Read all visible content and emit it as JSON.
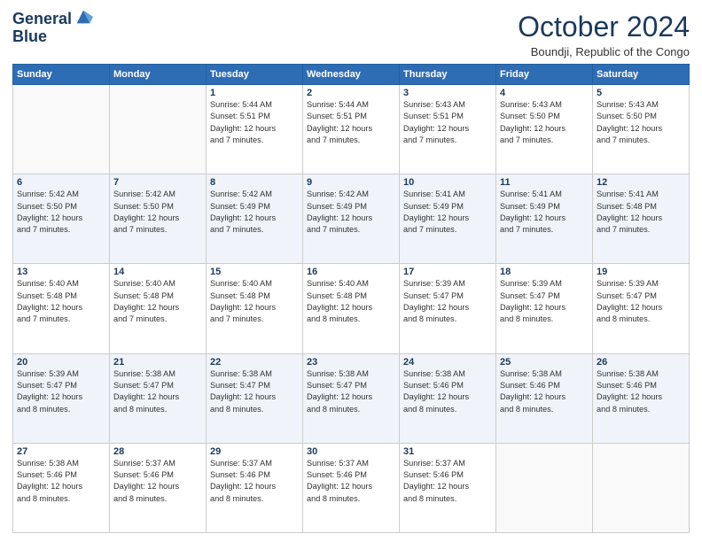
{
  "header": {
    "logo_line1": "General",
    "logo_line2": "Blue",
    "month": "October 2024",
    "location": "Boundji, Republic of the Congo"
  },
  "weekdays": [
    "Sunday",
    "Monday",
    "Tuesday",
    "Wednesday",
    "Thursday",
    "Friday",
    "Saturday"
  ],
  "weeks": [
    [
      {
        "day": "",
        "info": ""
      },
      {
        "day": "",
        "info": ""
      },
      {
        "day": "1",
        "info": "Sunrise: 5:44 AM\nSunset: 5:51 PM\nDaylight: 12 hours\nand 7 minutes."
      },
      {
        "day": "2",
        "info": "Sunrise: 5:44 AM\nSunset: 5:51 PM\nDaylight: 12 hours\nand 7 minutes."
      },
      {
        "day": "3",
        "info": "Sunrise: 5:43 AM\nSunset: 5:51 PM\nDaylight: 12 hours\nand 7 minutes."
      },
      {
        "day": "4",
        "info": "Sunrise: 5:43 AM\nSunset: 5:50 PM\nDaylight: 12 hours\nand 7 minutes."
      },
      {
        "day": "5",
        "info": "Sunrise: 5:43 AM\nSunset: 5:50 PM\nDaylight: 12 hours\nand 7 minutes."
      }
    ],
    [
      {
        "day": "6",
        "info": "Sunrise: 5:42 AM\nSunset: 5:50 PM\nDaylight: 12 hours\nand 7 minutes."
      },
      {
        "day": "7",
        "info": "Sunrise: 5:42 AM\nSunset: 5:50 PM\nDaylight: 12 hours\nand 7 minutes."
      },
      {
        "day": "8",
        "info": "Sunrise: 5:42 AM\nSunset: 5:49 PM\nDaylight: 12 hours\nand 7 minutes."
      },
      {
        "day": "9",
        "info": "Sunrise: 5:42 AM\nSunset: 5:49 PM\nDaylight: 12 hours\nand 7 minutes."
      },
      {
        "day": "10",
        "info": "Sunrise: 5:41 AM\nSunset: 5:49 PM\nDaylight: 12 hours\nand 7 minutes."
      },
      {
        "day": "11",
        "info": "Sunrise: 5:41 AM\nSunset: 5:49 PM\nDaylight: 12 hours\nand 7 minutes."
      },
      {
        "day": "12",
        "info": "Sunrise: 5:41 AM\nSunset: 5:48 PM\nDaylight: 12 hours\nand 7 minutes."
      }
    ],
    [
      {
        "day": "13",
        "info": "Sunrise: 5:40 AM\nSunset: 5:48 PM\nDaylight: 12 hours\nand 7 minutes."
      },
      {
        "day": "14",
        "info": "Sunrise: 5:40 AM\nSunset: 5:48 PM\nDaylight: 12 hours\nand 7 minutes."
      },
      {
        "day": "15",
        "info": "Sunrise: 5:40 AM\nSunset: 5:48 PM\nDaylight: 12 hours\nand 7 minutes."
      },
      {
        "day": "16",
        "info": "Sunrise: 5:40 AM\nSunset: 5:48 PM\nDaylight: 12 hours\nand 8 minutes."
      },
      {
        "day": "17",
        "info": "Sunrise: 5:39 AM\nSunset: 5:47 PM\nDaylight: 12 hours\nand 8 minutes."
      },
      {
        "day": "18",
        "info": "Sunrise: 5:39 AM\nSunset: 5:47 PM\nDaylight: 12 hours\nand 8 minutes."
      },
      {
        "day": "19",
        "info": "Sunrise: 5:39 AM\nSunset: 5:47 PM\nDaylight: 12 hours\nand 8 minutes."
      }
    ],
    [
      {
        "day": "20",
        "info": "Sunrise: 5:39 AM\nSunset: 5:47 PM\nDaylight: 12 hours\nand 8 minutes."
      },
      {
        "day": "21",
        "info": "Sunrise: 5:38 AM\nSunset: 5:47 PM\nDaylight: 12 hours\nand 8 minutes."
      },
      {
        "day": "22",
        "info": "Sunrise: 5:38 AM\nSunset: 5:47 PM\nDaylight: 12 hours\nand 8 minutes."
      },
      {
        "day": "23",
        "info": "Sunrise: 5:38 AM\nSunset: 5:47 PM\nDaylight: 12 hours\nand 8 minutes."
      },
      {
        "day": "24",
        "info": "Sunrise: 5:38 AM\nSunset: 5:46 PM\nDaylight: 12 hours\nand 8 minutes."
      },
      {
        "day": "25",
        "info": "Sunrise: 5:38 AM\nSunset: 5:46 PM\nDaylight: 12 hours\nand 8 minutes."
      },
      {
        "day": "26",
        "info": "Sunrise: 5:38 AM\nSunset: 5:46 PM\nDaylight: 12 hours\nand 8 minutes."
      }
    ],
    [
      {
        "day": "27",
        "info": "Sunrise: 5:38 AM\nSunset: 5:46 PM\nDaylight: 12 hours\nand 8 minutes."
      },
      {
        "day": "28",
        "info": "Sunrise: 5:37 AM\nSunset: 5:46 PM\nDaylight: 12 hours\nand 8 minutes."
      },
      {
        "day": "29",
        "info": "Sunrise: 5:37 AM\nSunset: 5:46 PM\nDaylight: 12 hours\nand 8 minutes."
      },
      {
        "day": "30",
        "info": "Sunrise: 5:37 AM\nSunset: 5:46 PM\nDaylight: 12 hours\nand 8 minutes."
      },
      {
        "day": "31",
        "info": "Sunrise: 5:37 AM\nSunset: 5:46 PM\nDaylight: 12 hours\nand 8 minutes."
      },
      {
        "day": "",
        "info": ""
      },
      {
        "day": "",
        "info": ""
      }
    ]
  ]
}
